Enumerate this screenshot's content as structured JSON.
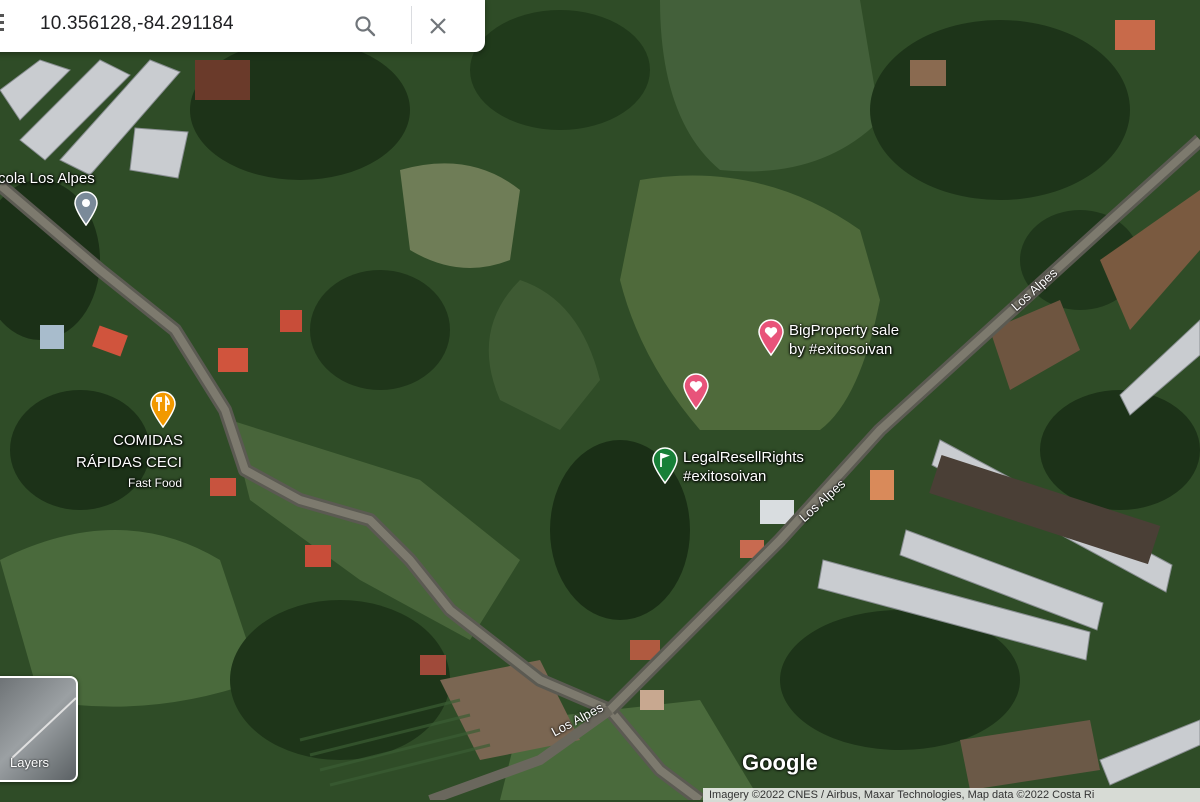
{
  "search": {
    "query": "10.356128,-84.291184",
    "search_icon": "search-icon",
    "close_icon": "close-icon",
    "menu_icon": "menu-icon"
  },
  "places": {
    "school": "Escuela Los Alpes",
    "school_visible": "cola Los Alpes",
    "restaurant_line1": "COMIDAS",
    "restaurant_line2": "RÁPIDAS CECI",
    "restaurant_category": "Fast Food",
    "pin1_line1": "BigProperty sale",
    "pin1_line2": "by #exitosoivan",
    "pin2_line1": "LegalResellRights",
    "pin2_line2": "#exitosoivan"
  },
  "roads": {
    "r1": "Los Alpes",
    "r2": "Los Alpes",
    "r3": "Los Alpes"
  },
  "controls": {
    "layers_label": "Layers"
  },
  "branding": {
    "logo": "Google",
    "attribution": "Imagery ©2022 CNES / Airbus, Maxar Technologies, Map data ©2022      Costa Ri"
  },
  "colors": {
    "pin_pink": "#e8537a",
    "pin_green": "#188038",
    "pin_gray": "#7a8a99",
    "food_orange": "#f29900"
  }
}
